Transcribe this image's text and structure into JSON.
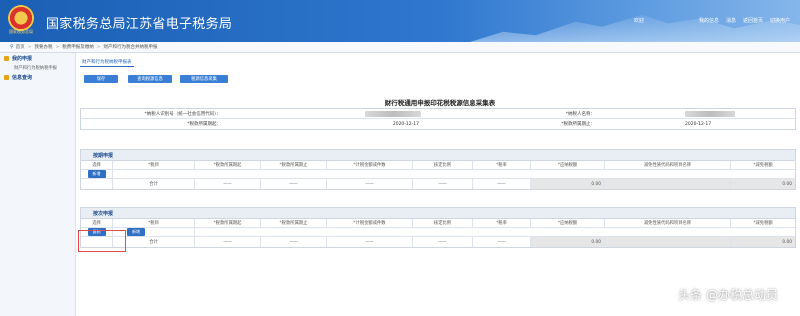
{
  "header": {
    "logo_caption": "国家税务总局",
    "title": "国家税务总局江苏省电子税务局",
    "links": [
      "欢迎",
      "我的信息",
      "消息",
      "返回首页",
      "切换用户"
    ]
  },
  "breadcrumb": [
    "首页",
    "我要办税",
    "税费申报及缴纳",
    "财产和行为税合并纳税申报"
  ],
  "sidebar": {
    "items": [
      {
        "label": "我的申报",
        "sub": [
          "财产和行为税纳税申报"
        ]
      },
      {
        "label": "信息查询",
        "sub": []
      }
    ]
  },
  "main": {
    "tab": "财产和行为税纳税申报表",
    "buttons": [
      "保存",
      "查询税源信息",
      "税源信息采集"
    ],
    "form_title": "财行税通用申报印花税税源信息采集表",
    "info": {
      "taxpayer_id_label": "*纳税人识别号（统一社会信用代码）：",
      "taxpayer_name_label": "*纳税人名称：",
      "period_start_label": "*税款所属期起：",
      "period_start": "2020-12-17",
      "period_end_label": "*税款所属期止：",
      "period_end": "2020-12-17"
    },
    "section1": {
      "title": "按期申报",
      "headers": [
        "选择",
        "*税目",
        "*税款所属期起",
        "*税款所属期止",
        "*计税金额或件数",
        "核定比例",
        "*税率",
        "*应纳税额",
        "减免性质代码和项目名称",
        "*减免税额"
      ],
      "add_btn": "新增",
      "total_label": "合计",
      "dashes": [
        "——",
        "——",
        "——",
        "——",
        "——"
      ],
      "tax_due": "0.00",
      "relief": "0.00"
    },
    "section2": {
      "title": "按次申报",
      "headers": [
        "选择",
        "*税目",
        "*税款所属期起",
        "*税款所属期止",
        "*计税金额或件数",
        "核定比例",
        "*税率",
        "*应纳税额",
        "减免性质代码和项目名称",
        "*减免税额"
      ],
      "dup_btn": "复制",
      "add_btn": "新增",
      "total_label": "合计",
      "dashes": [
        "——",
        "——",
        "——",
        "——",
        "——"
      ],
      "tax_due": "0.00",
      "relief": "0.00"
    }
  },
  "watermark": "头条 @办税总动员",
  "colors": {
    "primary": "#2f77cf",
    "button": "#3a7fd5",
    "highlight": "#e04a4a"
  }
}
